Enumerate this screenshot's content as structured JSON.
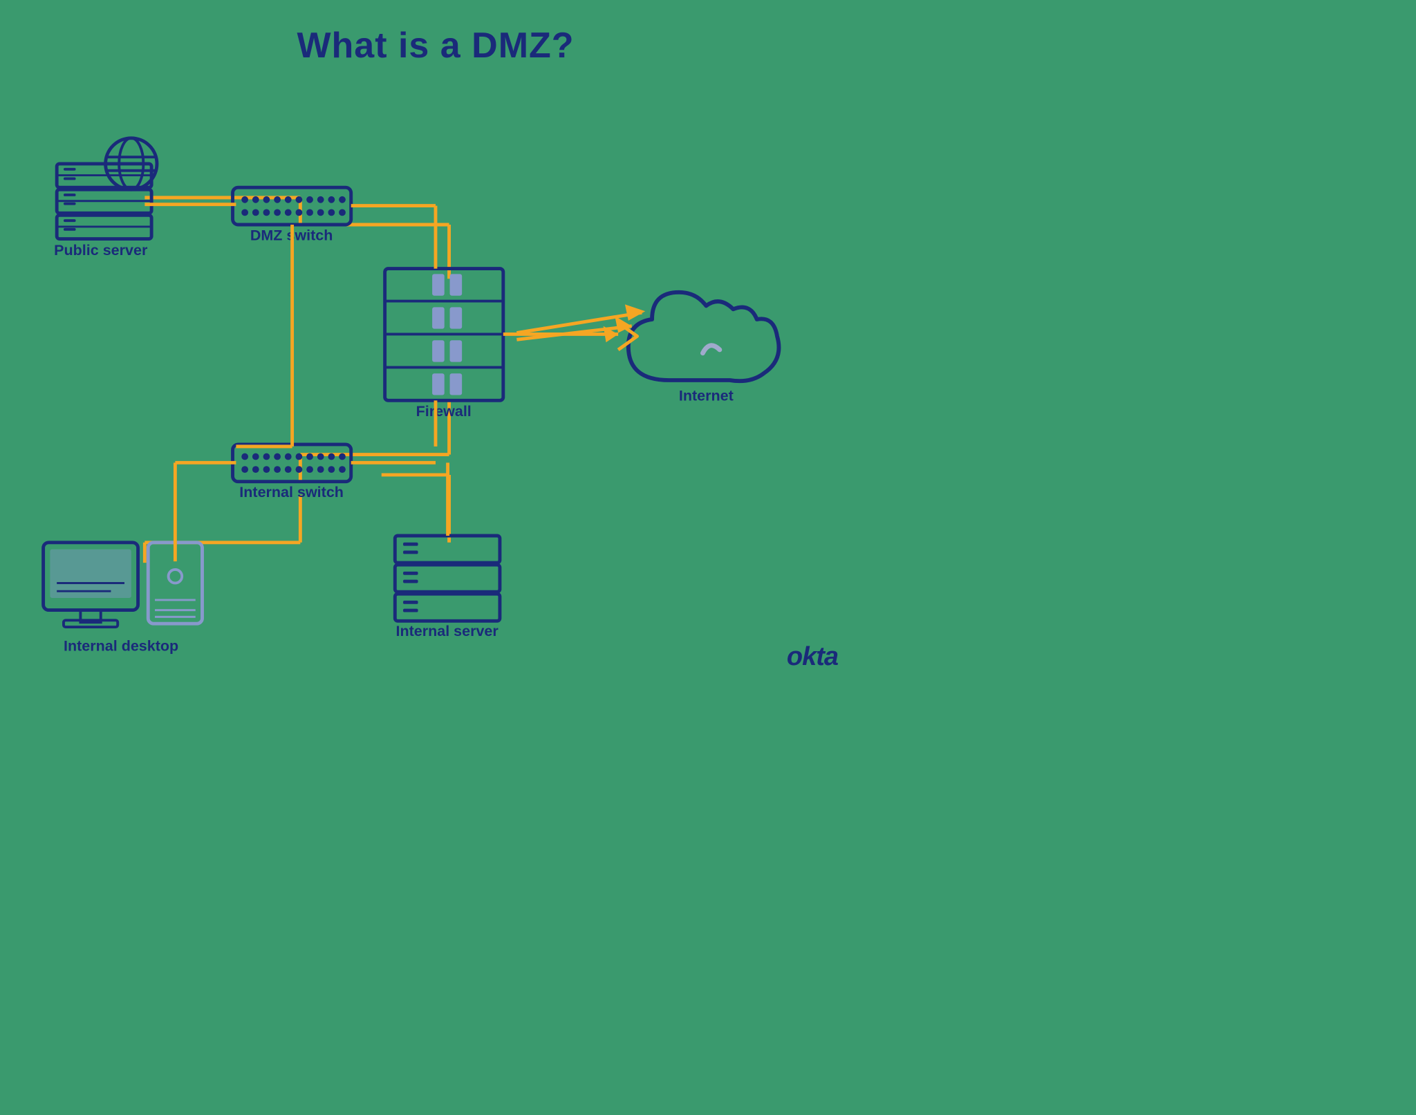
{
  "title": "What is a DMZ?",
  "labels": {
    "public_server": "Public server",
    "dmz_switch": "DMZ switch",
    "firewall": "Firewall",
    "internet": "Internet",
    "internal_switch": "Internal switch",
    "internal_desktop": "Internal desktop",
    "internal_server": "Internal server",
    "okta": "okta"
  },
  "colors": {
    "navy": "#1a2a7a",
    "navy_mid": "#1a3a8a",
    "orange": "#f5a623",
    "light_blue": "#a0aacc",
    "green_bg": "#3a9a6e",
    "white": "#ffffff"
  }
}
